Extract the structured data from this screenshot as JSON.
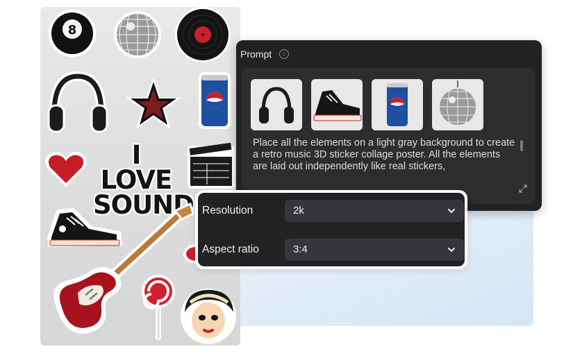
{
  "poster": {
    "headline_line1": "I LOVE",
    "headline_line2": "SOUND",
    "ball_number": "8",
    "stickers": [
      "eight-ball",
      "disco-ball",
      "vinyl-record",
      "headphones",
      "star",
      "soda-can",
      "heart",
      "clapperboard",
      "sneaker",
      "guitar",
      "lollipop",
      "pinup-girl",
      "lips"
    ]
  },
  "prompt": {
    "label": "Prompt",
    "info_icon": "info-icon",
    "reference_images": [
      {
        "icon": "headphones-thumb"
      },
      {
        "icon": "sneaker-thumb"
      },
      {
        "icon": "soda-can-thumb"
      },
      {
        "icon": "disco-ball-thumb"
      }
    ],
    "text": "Place all the elements on a light gray background to create a retro music 3D sticker collage poster. All the elements are laid out independently like real stickers,",
    "expand_icon": "expand-icon"
  },
  "settings": {
    "resolution": {
      "label": "Resolution",
      "value": "2k"
    },
    "aspect_ratio": {
      "label": "Aspect ratio",
      "value": "3:4"
    }
  },
  "colors": {
    "panel_bg": "#222224",
    "field_bg": "#36363a",
    "poster_bg": "#e3e3e3",
    "accent_red": "#c8202c",
    "can_blue": "#1d4fa3"
  }
}
